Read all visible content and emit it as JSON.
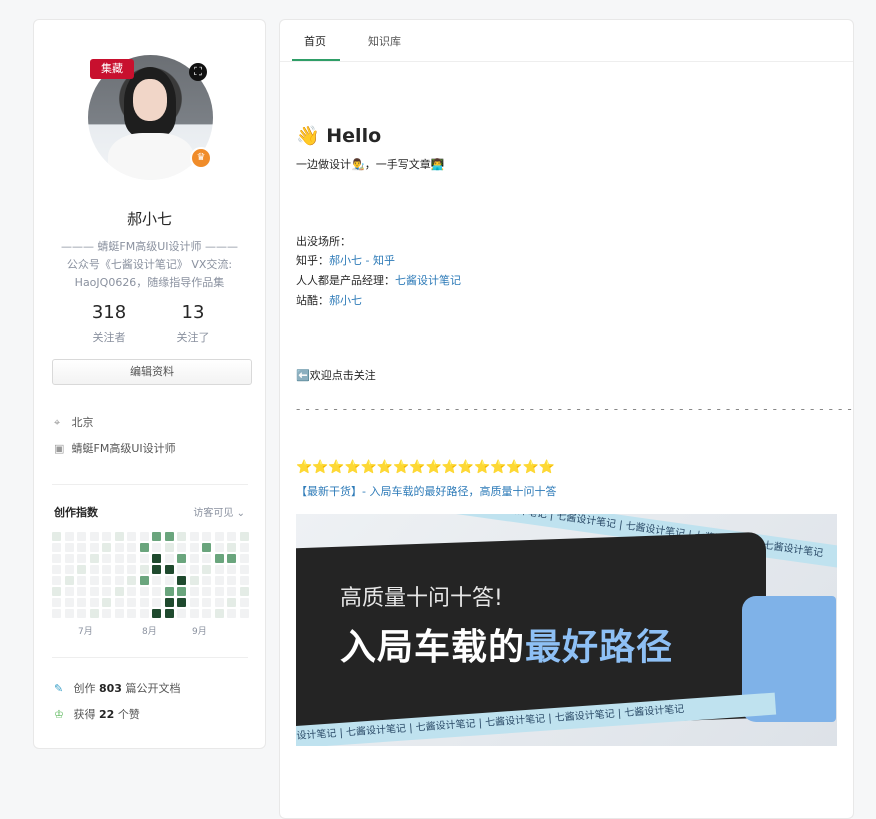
{
  "profile": {
    "badge_collect": "集藏",
    "name": "郝小七",
    "bio_line1": "——— 蜻蜓FM高级UI设计师 ———",
    "bio_line2": "公众号《七酱设计笔记》 VX交流:",
    "bio_line3": "HaoJQ0626，随缘指导作品集",
    "followers": {
      "count": "318",
      "label": "关注者"
    },
    "following": {
      "count": "13",
      "label": "关注了"
    },
    "edit_label": "编辑资料",
    "location": "北京",
    "job": "蜻蜓FM高级UI设计师",
    "creation_index": {
      "title": "创作指数",
      "visibility": "访客可见",
      "months": [
        "7月",
        "8月",
        "9月"
      ]
    },
    "docs": {
      "prefix": "创作",
      "count": "803",
      "suffix": "篇公开文档"
    },
    "likes": {
      "prefix": "获得",
      "count": "22",
      "suffix": "个赞"
    }
  },
  "tabs": [
    {
      "label": "首页",
      "active": true
    },
    {
      "label": "知识库",
      "active": false
    }
  ],
  "content": {
    "hello": "👋 Hello",
    "subtitle": "一边做设计👨‍🎨，一手写文章👨‍💻",
    "appear_label": "出没场所：",
    "zhihu_label": "知乎：",
    "zhihu_link": "郝小七 - 知乎",
    "pm_label": "人人都是产品经理：",
    "pm_link": "七酱设计笔记",
    "zcool_label": "站酷：",
    "zcool_link": "郝小七",
    "welcome": "⬅️欢迎点击关注",
    "dashes": "- - - - - - - - - - - - - - - - - - - - - - - - - - - - - - - - - - - - - - - - - - - - - - - - - - - - - - - - - - - -",
    "stars": "⭐⭐⭐⭐⭐⭐⭐⭐⭐⭐⭐⭐⭐⭐⭐⭐",
    "headline": "【最新干货】- 入局车载的最好路径，高质量十问十答",
    "banner": {
      "line1": "高质量十问十答!",
      "line2_a": "入局车载的",
      "line2_b": "最好路径",
      "ribbon": "七酱设计笔记 | 七酱设计笔记 | 七酱设计笔记 | 七酱设计笔记 | 七酱设计笔记 | 七酱设计笔记"
    }
  }
}
